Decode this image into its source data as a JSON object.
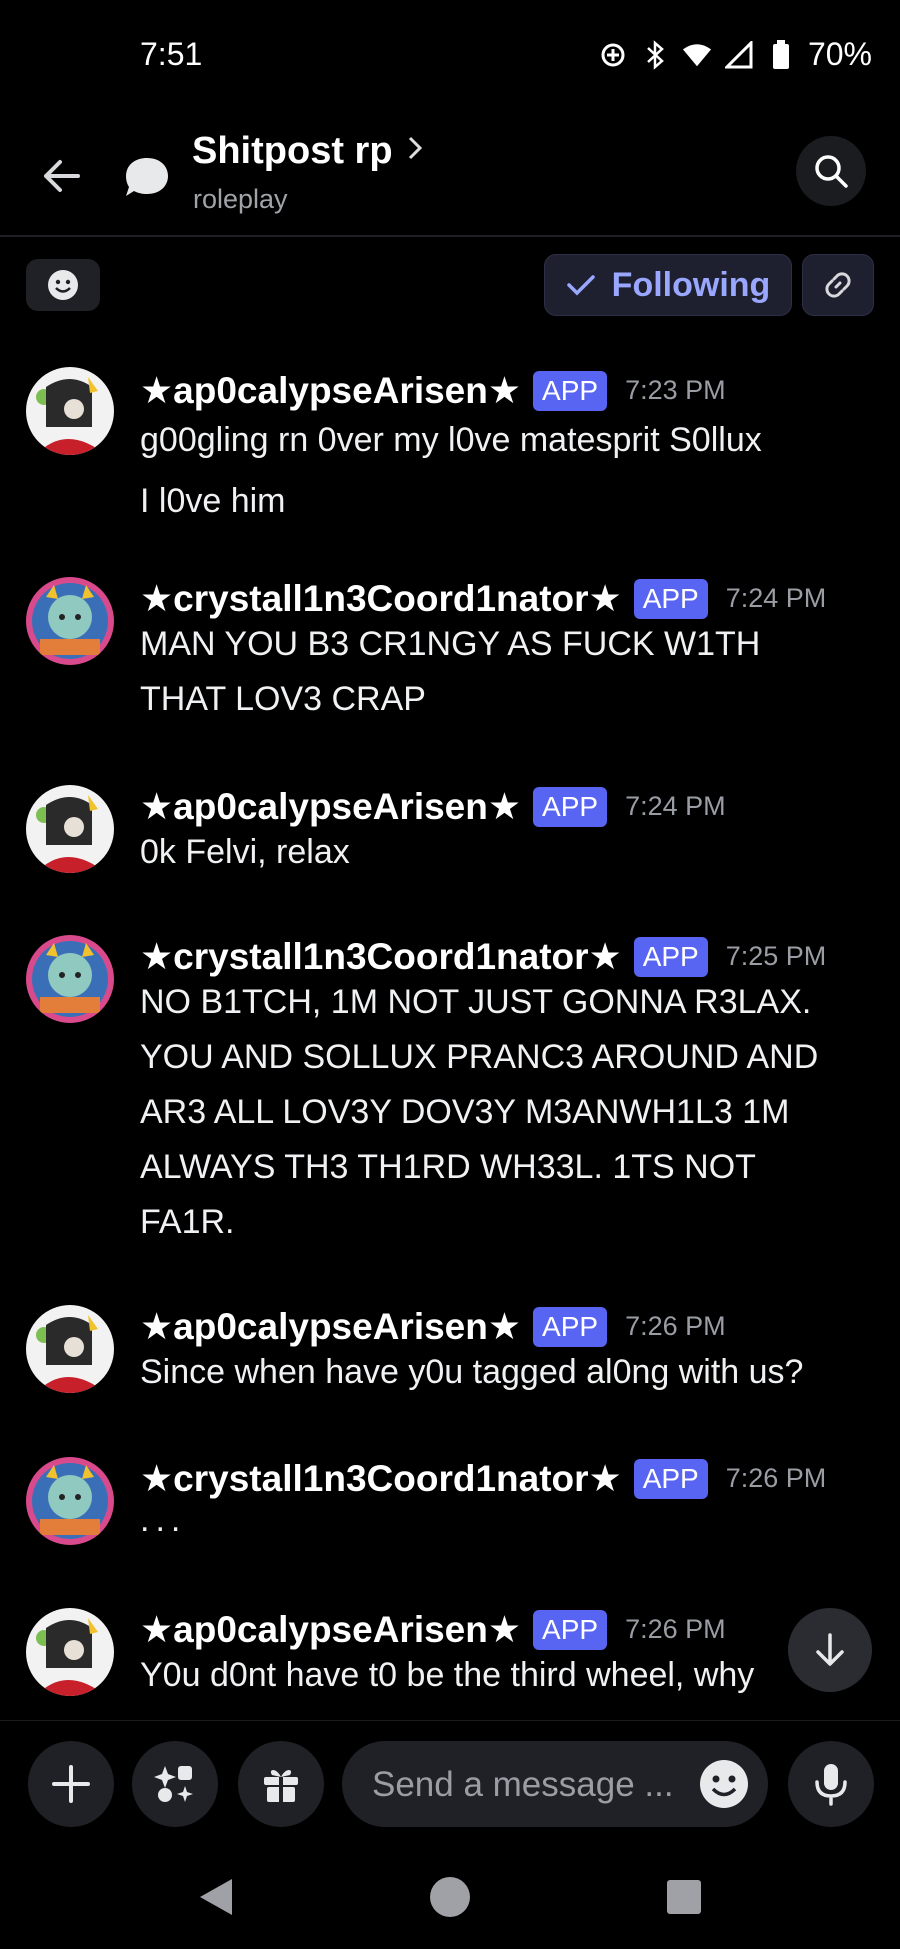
{
  "status_bar": {
    "time": "7:51",
    "battery": "70%"
  },
  "header": {
    "title": "Shitpost rp",
    "subtitle": "roleplay"
  },
  "actions": {
    "following_label": "Following"
  },
  "messages": [
    {
      "author": "★ap0calypseArisen★",
      "badge": "APP",
      "time": "7:23 PM",
      "lines": [
        "g00gling rn 0ver my l0ve matesprit S0llux",
        "I l0ve him"
      ],
      "avatar": "terezi-style"
    },
    {
      "author": "★crystall1n3Coord1nator★",
      "badge": "APP",
      "time": "7:24 PM",
      "lines": [
        "MAN YOU B3 CR1NGY AS FUCK W1TH",
        "THAT LOV3 CRAP"
      ],
      "avatar": "troll-style"
    },
    {
      "author": "★ap0calypseArisen★",
      "badge": "APP",
      "time": "7:24 PM",
      "lines": [
        "0k Felvi, relax"
      ],
      "avatar": "terezi-style"
    },
    {
      "author": "★crystall1n3Coord1nator★",
      "badge": "APP",
      "time": "7:25 PM",
      "lines": [
        "NO B1TCH, 1M NOT JUST GONNA R3LAX.",
        "YOU AND SOLLUX PRANC3 AROUND AND",
        "AR3 ALL LOV3Y DOV3Y M3ANWH1L3 1M",
        "ALWAYS TH3 TH1RD WH33L. 1TS NOT",
        "FA1R."
      ],
      "avatar": "troll-style"
    },
    {
      "author": "★ap0calypseArisen★",
      "badge": "APP",
      "time": "7:26 PM",
      "lines": [
        "Since when have y0u tagged al0ng with us?"
      ],
      "avatar": "terezi-style"
    },
    {
      "author": "★crystall1n3Coord1nator★",
      "badge": "APP",
      "time": "7:26 PM",
      "lines": [
        "..."
      ],
      "avatar": "troll-style"
    },
    {
      "author": "★ap0calypseArisen★",
      "badge": "APP",
      "time": "7:26 PM",
      "lines": [
        "Y0u d0nt have t0 be the third wheel, why"
      ],
      "avatar": "terezi-style"
    }
  ],
  "composer": {
    "placeholder": "Send a message ..."
  },
  "colors": {
    "accent": "#5865f2",
    "background": "#000000",
    "following_text": "#9aa7ff"
  }
}
